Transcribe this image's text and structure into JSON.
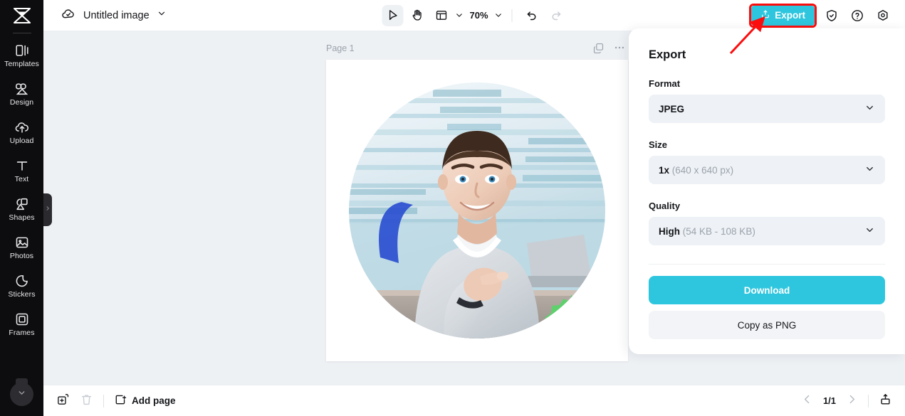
{
  "app": {
    "brand_icon": "capcut-logo-icon",
    "accent_color": "#2ec6de",
    "annotation_color": "#fb0d0d",
    "canvas_background": "#eef1f4",
    "sidebar_background": "#0d0d0f"
  },
  "sidebar": {
    "items": [
      {
        "label": "Templates",
        "icon": "templates-icon"
      },
      {
        "label": "Design",
        "icon": "design-icon"
      },
      {
        "label": "Upload",
        "icon": "upload-cloud-icon"
      },
      {
        "label": "Text",
        "icon": "text-icon"
      },
      {
        "label": "Shapes",
        "icon": "shapes-icon"
      },
      {
        "label": "Photos",
        "icon": "photos-icon"
      },
      {
        "label": "Stickers",
        "icon": "stickers-icon"
      },
      {
        "label": "Frames",
        "icon": "frames-icon"
      }
    ],
    "more_icon": "chevron-down-icon",
    "collapse_handle_icon": "chevron-right-icon"
  },
  "topbar": {
    "cloud_icon": "cloud-saved-icon",
    "doc_title": "Untitled image",
    "doc_menu_icon": "chevron-down-icon",
    "tools": [
      {
        "name": "select-tool",
        "icon": "cursor-arrow-icon",
        "active": true
      },
      {
        "name": "hand-tool",
        "icon": "hand-icon",
        "active": false
      },
      {
        "name": "layout-tool",
        "icon": "layout-icon",
        "active": false
      }
    ],
    "layout_caret_icon": "chevron-down-icon",
    "zoom_level": "70%",
    "zoom_caret_icon": "chevron-down-icon",
    "undo_icon": "undo-icon",
    "redo_icon": "redo-icon",
    "export_label": "Export",
    "export_icon": "export-upload-icon",
    "export_highlighted": true,
    "right_icons": [
      {
        "name": "shield-check-icon"
      },
      {
        "name": "help-question-icon"
      },
      {
        "name": "settings-gear-icon"
      }
    ]
  },
  "canvas": {
    "page_label": "Page 1",
    "page_duplicate_icon": "duplicate-icon",
    "page_more_icon": "more-horizontal-icon",
    "artwork": {
      "description": "circular photo of a smiling man pointing at camera",
      "badge_icon": "green-verified-check-badge",
      "badge_color": "#5ed16d"
    }
  },
  "export_panel": {
    "title": "Export",
    "fields": [
      {
        "label": "Format",
        "value": "JPEG",
        "detail": "",
        "caret_icon": "chevron-down-icon"
      },
      {
        "label": "Size",
        "value": "1x",
        "detail": "(640 x 640 px)",
        "caret_icon": "chevron-down-icon"
      },
      {
        "label": "Quality",
        "value": "High",
        "detail": "(54 KB - 108 KB)",
        "caret_icon": "chevron-down-icon"
      }
    ],
    "download_label": "Download",
    "copy_label": "Copy as PNG"
  },
  "bottombar": {
    "duplicate_icon": "duplicate-page-icon",
    "delete_icon": "trash-icon",
    "add_page_label": "Add page",
    "add_page_icon": "add-square-icon",
    "prev_icon": "chevron-left-icon",
    "page_count": "1/1",
    "next_icon": "chevron-right-icon",
    "export_icon": "export-tray-icon"
  }
}
